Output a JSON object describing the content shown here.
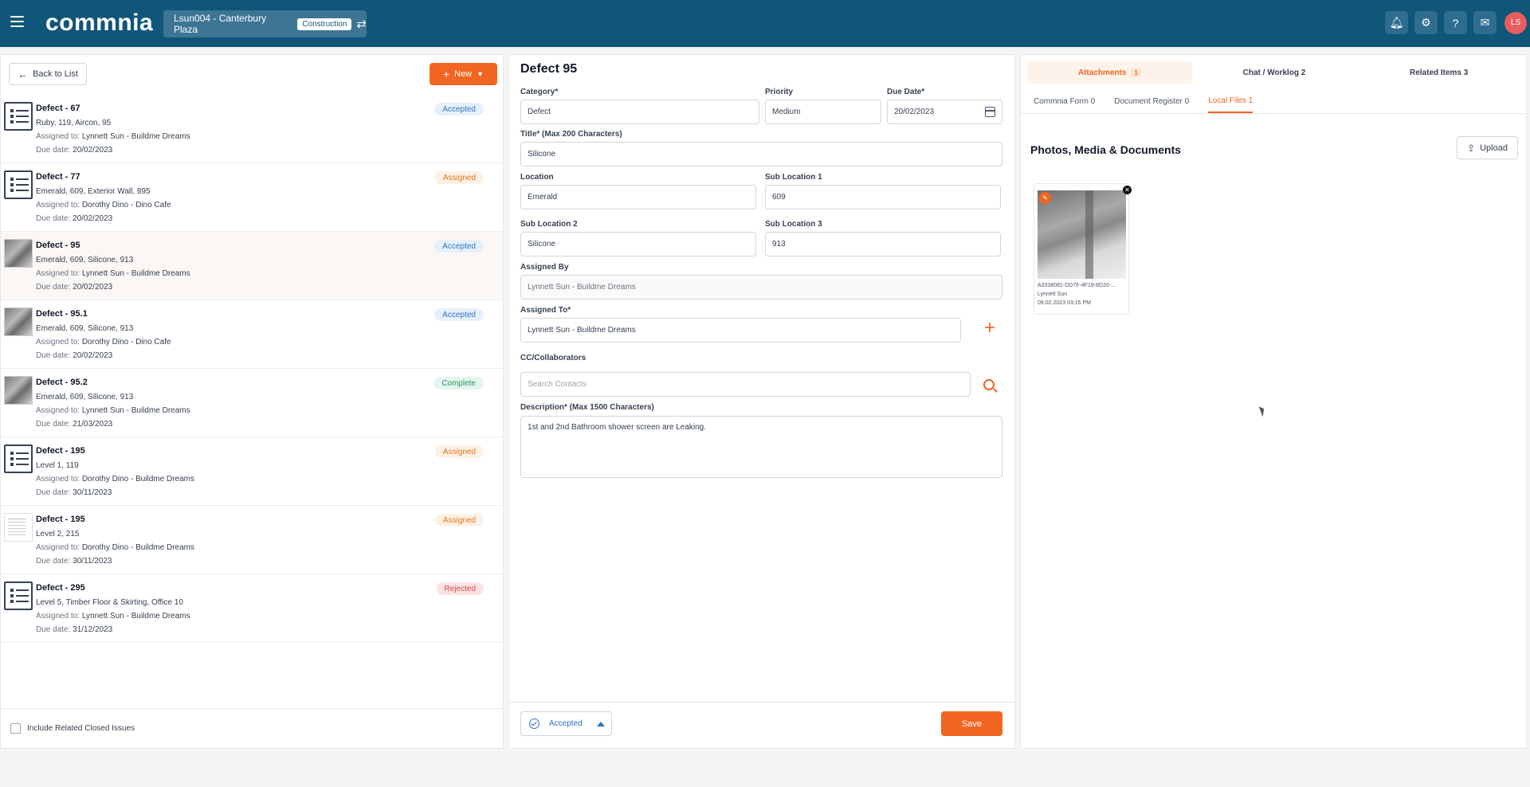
{
  "header": {
    "logo": "commnia",
    "project": "Lsun004 - Canterbury Plaza",
    "project_tag": "Construction",
    "user_initials": "LS"
  },
  "left": {
    "back_label": "Back to List",
    "new_label": "New",
    "include_closed_label": "Include Related Closed Issues",
    "issues": [
      {
        "title": "Defect - 67",
        "location": "Ruby, 119, Aircon, 95",
        "assigned_label": "Assigned to:",
        "assigned_to": "Lynnett Sun - Buildme Dreams",
        "due_label": "Due date:",
        "due": "20/02/2023",
        "status": "Accepted",
        "thumb": "list"
      },
      {
        "title": "Defect - 77",
        "location": "Emerald, 609, Exterior Wall, 895",
        "assigned_label": "Assigned to:",
        "assigned_to": "Dorothy Dino - Dino Cafe",
        "due_label": "Due date:",
        "due": "20/02/2023",
        "status": "Assigned",
        "thumb": "list"
      },
      {
        "title": "Defect - 95",
        "location": "Emerald, 609, Silicone, 913",
        "assigned_label": "Assigned to:",
        "assigned_to": "Lynnett Sun - Buildme Dreams",
        "due_label": "Due date:",
        "due": "20/02/2023",
        "status": "Accepted",
        "thumb": "photo"
      },
      {
        "title": "Defect - 95.1",
        "location": "Emerald, 609, Silicone, 913",
        "assigned_label": "Assigned to:",
        "assigned_to": "Dorothy Dino - Dino Cafe",
        "due_label": "Due date:",
        "due": "20/02/2023",
        "status": "Accepted",
        "thumb": "photo"
      },
      {
        "title": "Defect - 95.2",
        "location": "Emerald, 609, Silicone, 913",
        "assigned_label": "Assigned to:",
        "assigned_to": "Lynnett Sun - Buildme Dreams",
        "due_label": "Due date:",
        "due": "21/03/2023",
        "status": "Complete",
        "thumb": "photo"
      },
      {
        "title": "Defect - 195",
        "location": "Level 1, 119",
        "assigned_label": "Assigned to:",
        "assigned_to": "Dorothy Dino - Buildme Dreams",
        "due_label": "Due date:",
        "due": "30/11/2023",
        "status": "Assigned",
        "thumb": "list"
      },
      {
        "title": "Defect - 195",
        "location": "Level 2, 215",
        "assigned_label": "Assigned to:",
        "assigned_to": "Dorothy Dino - Buildme Dreams",
        "due_label": "Due date:",
        "due": "30/11/2023",
        "status": "Assigned",
        "thumb": "doc"
      },
      {
        "title": "Defect - 295",
        "location": "Level 5, Timber Floor & Skirting, Office 10",
        "assigned_label": "Assigned to:",
        "assigned_to": "Lynnett Sun - Buildme Dreams",
        "due_label": "Due date:",
        "due": "31/12/2023",
        "status": "Rejected",
        "thumb": "list"
      }
    ]
  },
  "form": {
    "title": "Defect 95",
    "category_label": "Category*",
    "category": "Defect",
    "priority_label": "Priority",
    "priority": "Medium",
    "due_label": "Due Date*",
    "due": "20/02/2023",
    "title_label": "Title* (Max 200 Characters)",
    "title_value": "Silicone",
    "location_label": "Location",
    "location": "Emerald",
    "sub1_label": "Sub Location 1",
    "sub1": "609",
    "sub2_label": "Sub Location 2",
    "sub2": "Silicone",
    "sub3_label": "Sub Location 3",
    "sub3": "913",
    "assigned_by_label": "Assigned By",
    "assigned_by": "Lynnett Sun - Buildme Dreams",
    "assigned_to_label": "Assigned To*",
    "assigned_to": "Lynnett Sun - Buildme Dreams",
    "cc_label": "CC/Collaborators",
    "search_placeholder": "Search Contacts",
    "description_label": "Description* (Max 1500 Characters)",
    "description": "1st and 2nd Bathroom shower screen are Leaking.",
    "status": "Accepted",
    "save_label": "Save"
  },
  "right": {
    "tabs": [
      {
        "label": "Attachments",
        "count": "1",
        "active": true
      },
      {
        "label": "Chat / Worklog 2",
        "active": false
      },
      {
        "label": "Related Items 3",
        "active": false
      }
    ],
    "sub_tabs": [
      {
        "label": "Commnia Form 0"
      },
      {
        "label": "Document Register 0"
      },
      {
        "label": "Local Files 1"
      }
    ],
    "section_title": "Photos, Media & Documents",
    "upload_label": "Upload",
    "file": {
      "name": "A3338081-DD7F-4F19-8D20-...",
      "owner": "Lynnett Sun",
      "date": "09.02.2023 03:15 PM"
    }
  },
  "colors": {
    "header_bg": "#0f5679",
    "accent": "#f26522"
  }
}
